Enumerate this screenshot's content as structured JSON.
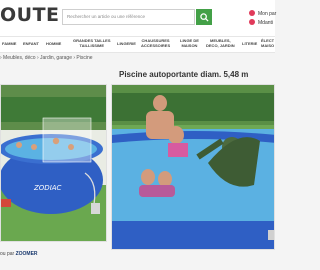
{
  "header": {
    "logo_text": "OUTE",
    "search_placeholder": "Rechercher un article ou une référence",
    "account": {
      "line1": "Mon par",
      "line2": "Mdanti"
    }
  },
  "nav": {
    "items": [
      {
        "label": "FAMME"
      },
      {
        "label": "ENFANT"
      },
      {
        "label": "HOMME"
      },
      {
        "label": "GRANDES TAILLES\nTAILLISSIME"
      },
      {
        "label": "LINGERIE"
      },
      {
        "label": "CHAUSSURES\nACCESSOIRES"
      },
      {
        "label": "LINGE DE\nMAISON"
      },
      {
        "label": "MEUBLES,\nDECO, JARDIN"
      },
      {
        "label": "LITERIE"
      },
      {
        "label": "ÉLECT\nMAISO"
      }
    ]
  },
  "breadcrumb": {
    "text": "› Meubles, déco › Jardin, garage › Piscine"
  },
  "product": {
    "title": "Piscine autoportante diam. 5,48 m",
    "brand_on_pool": "ZODIAC"
  },
  "vendor": {
    "prefix": "ou par ",
    "name": "ZOOMER"
  },
  "colors": {
    "accent_green": "#43a047",
    "pool_blue": "#2f5fc4",
    "water": "#4aa3d8",
    "grass": "#4f9a3a",
    "account_red": "#e03a5a"
  }
}
